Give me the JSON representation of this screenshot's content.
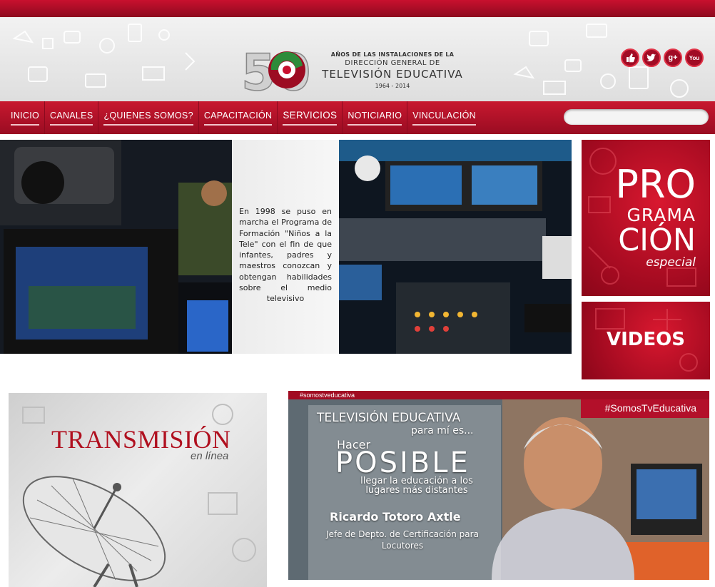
{
  "header": {
    "logo_number": "50",
    "logo_line1": "AÑOS DE LAS INSTALACIONES DE LA",
    "logo_line2": "DIRECCIÓN GENERAL DE",
    "logo_line3": "TELEVISIÓN EDUCATIVA",
    "logo_years": "1964 - 2014",
    "social": [
      {
        "name": "like-icon",
        "label": "👍"
      },
      {
        "name": "twitter-icon",
        "label": "t"
      },
      {
        "name": "google-plus-icon",
        "label": "g+"
      },
      {
        "name": "youtube-icon",
        "label": "You"
      }
    ]
  },
  "nav": {
    "items": [
      "INICIO",
      "CANALES",
      "¿QUIENES SOMOS?",
      "CAPACITACIÓN",
      "SERVICIOS",
      "NOTICIARIO",
      "VINCULACIÓN"
    ],
    "search_placeholder": ""
  },
  "feature": {
    "text": "En 1998 se puso en marcha el Programa de Formación \"Niños a la Tele\" con el fin de que infantes, padres y maestros conozcan y obtengan habilidades sobre el medio televisivo"
  },
  "promo_programacion": {
    "line1": "PRO",
    "line2": "GRAMA",
    "line3": "CIÓN",
    "line4": "especial"
  },
  "promo_videos": {
    "label": "VIDEOS"
  },
  "transmision": {
    "title": "TRANSMISIÓN",
    "subtitle": "en línea"
  },
  "campaign": {
    "tag": "#somostveducativa",
    "hashtag": "#SomosTvEducativa",
    "line1": "TELEVISIÓN EDUCATIVA",
    "line2": "para mí es...",
    "line3": "Hacer",
    "line4": "POSIBLE",
    "line5": "llegar la educación a los lugares más distantes",
    "name": "Ricardo Totoro Axtle",
    "role": "Jefe de Depto. de Certificación para Locutores"
  },
  "colors": {
    "brand_red": "#c8102e",
    "dark_red": "#8e0a1f"
  }
}
